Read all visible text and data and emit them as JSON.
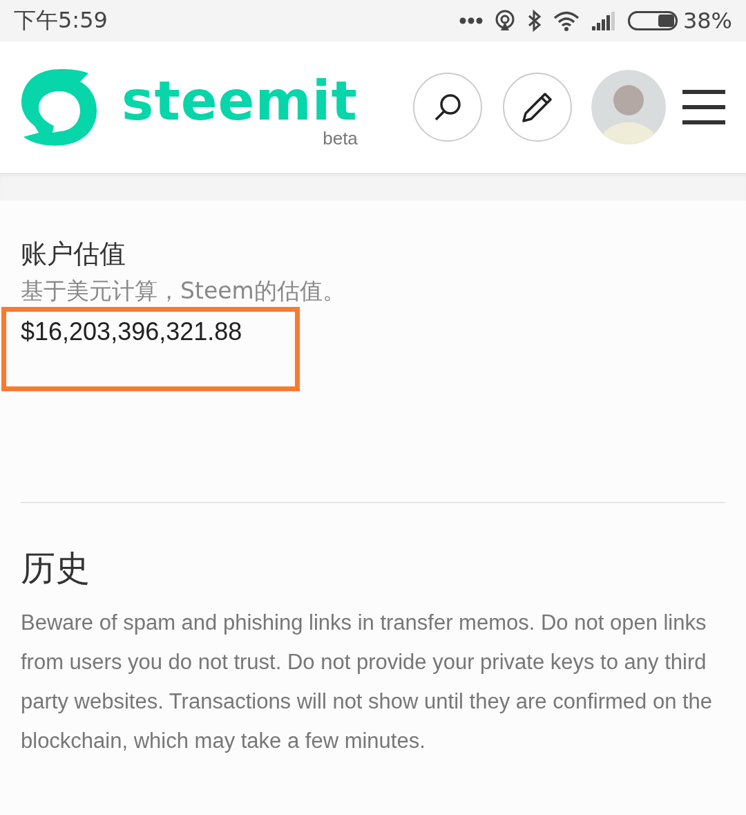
{
  "status_bar": {
    "time": "下午5:59",
    "battery": "38%"
  },
  "header": {
    "logo": "steemit",
    "logo_tag": "beta"
  },
  "valuation": {
    "title": "账户估值",
    "subtitle": "基于美元计算，Steem的估值。",
    "value": "$16,203,396,321.88",
    "highlighted": true
  },
  "history": {
    "title": "历史",
    "notice": "Beware of spam and phishing links in transfer memos. Do not open links from users you do not trust. Do not provide your private keys to any third party websites. Transactions will not show until they are confirmed on the blockchain, which may take a few minutes."
  }
}
